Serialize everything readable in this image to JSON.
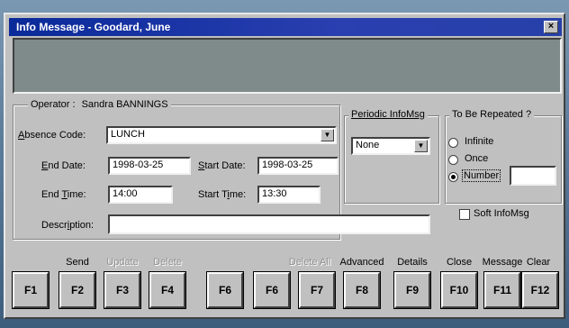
{
  "window": {
    "title": "Info Message - Goodard, June",
    "close_glyph": "×"
  },
  "operator": {
    "label": "Operator :",
    "name": "Sandra BANNINGS"
  },
  "form": {
    "absence_code_label": "Absence Code:",
    "absence_code_value": "LUNCH",
    "end_date_label": "End Date:",
    "end_date_value": "1998-03-25",
    "start_date_label": "Start Date:",
    "start_date_value": "1998-03-25",
    "end_time_label": "End Time:",
    "end_time_value": "14:00",
    "start_time_label": "Start Time:",
    "start_time_value": "13:30",
    "description_label": "Description:",
    "description_value": ""
  },
  "periodic": {
    "label": "Periodic InfoMsg",
    "value": "None"
  },
  "repeat": {
    "label": "To Be Repeated ?",
    "options": [
      "Infinite",
      "Once",
      "Number"
    ],
    "selected": "Number",
    "number_value": ""
  },
  "soft_infomsg": {
    "label": "Soft InfoMsg",
    "checked": false
  },
  "fkeys": [
    {
      "key": "F1",
      "label": "",
      "enabled": true
    },
    {
      "key": "F2",
      "label": "Send",
      "enabled": true
    },
    {
      "key": "F3",
      "label": "Update",
      "enabled": false
    },
    {
      "key": "F4",
      "label": "Delete",
      "enabled": false
    },
    {
      "key": "F6",
      "label": "",
      "enabled": true
    },
    {
      "key": "F6",
      "label": "",
      "enabled": true
    },
    {
      "key": "F7",
      "label": "Delete All",
      "enabled": false
    },
    {
      "key": "F8",
      "label": "Advanced",
      "enabled": true
    },
    {
      "key": "F9",
      "label": "Details",
      "enabled": true
    },
    {
      "key": "F10",
      "label": "Close",
      "enabled": true
    },
    {
      "key": "F11",
      "label": "Message",
      "enabled": true
    },
    {
      "key": "F12",
      "label": "Clear",
      "enabled": true
    }
  ],
  "icons": {
    "dropdown": "chevron-down-icon",
    "close": "close-icon"
  }
}
